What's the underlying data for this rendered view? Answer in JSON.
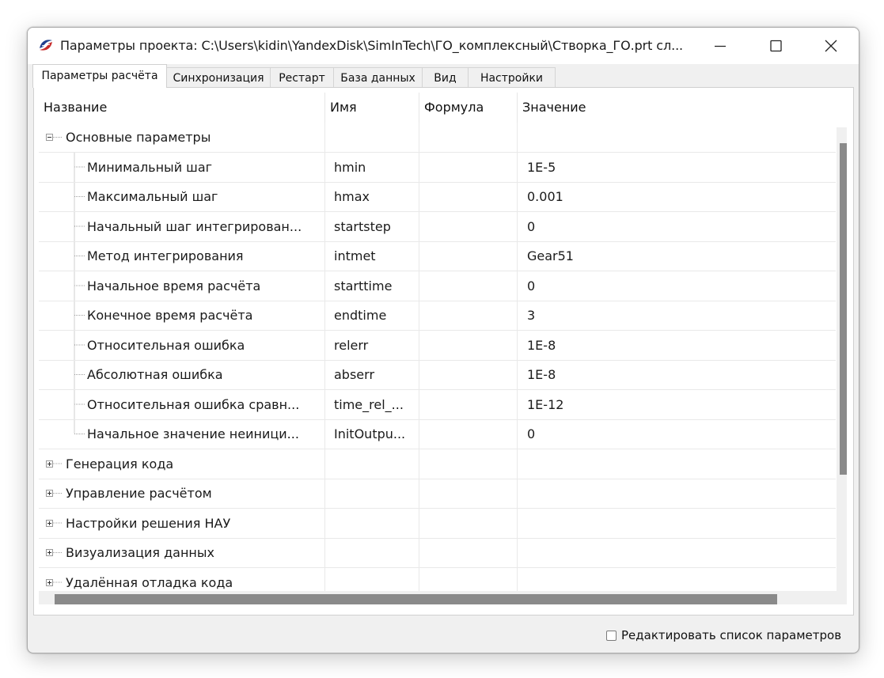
{
  "window": {
    "title": "Параметры проекта: C:\\Users\\kidin\\YandexDisk\\SimInTech\\ГО_комплексный\\Створка_ГО.prt  сл...",
    "icon": "simintech-logo-icon",
    "controls": [
      "minimize-icon",
      "maximize-icon",
      "close-icon"
    ]
  },
  "tabs": [
    {
      "label": "Параметры расчёта",
      "active": true
    },
    {
      "label": "Синхронизация",
      "active": false
    },
    {
      "label": "Рестарт",
      "active": false
    },
    {
      "label": "База данных",
      "active": false
    },
    {
      "label": "Вид",
      "active": false
    },
    {
      "label": "Настройки",
      "active": false
    }
  ],
  "table": {
    "columns": [
      "Название",
      "Имя",
      "Формула",
      "Значение"
    ],
    "rows": [
      {
        "name": "Основные параметры",
        "var": "",
        "formula": "",
        "value": "",
        "level": 0,
        "expander": "minus"
      },
      {
        "name": "Минимальный шаг",
        "var": "hmin",
        "formula": "",
        "value": "1E-5",
        "level": 1
      },
      {
        "name": "Максимальный шаг",
        "var": "hmax",
        "formula": "",
        "value": "0.001",
        "level": 1
      },
      {
        "name": "Начальный шаг интегрирован...",
        "var": "startstep",
        "formula": "",
        "value": "0",
        "level": 1
      },
      {
        "name": "Метод интегрирования",
        "var": "intmet",
        "formula": "",
        "value": "Gear51",
        "level": 1
      },
      {
        "name": "Начальное время расчёта",
        "var": "starttime",
        "formula": "",
        "value": "0",
        "level": 1
      },
      {
        "name": "Конечное время расчёта",
        "var": "endtime",
        "formula": "",
        "value": "3",
        "level": 1
      },
      {
        "name": "Относительная ошибка",
        "var": "relerr",
        "formula": "",
        "value": "1E-8",
        "level": 1
      },
      {
        "name": "Абсолютная ошибка",
        "var": "abserr",
        "formula": "",
        "value": "1E-8",
        "level": 1
      },
      {
        "name": "Относительная ошибка сравн...",
        "var": "time_rel_...",
        "formula": "",
        "value": "1E-12",
        "level": 1
      },
      {
        "name": "Начальное значение неиници...",
        "var": "InitOutpu...",
        "formula": "",
        "value": "0",
        "level": 1
      },
      {
        "name": "Генерация кода",
        "var": "",
        "formula": "",
        "value": "",
        "level": 0,
        "expander": "plus"
      },
      {
        "name": "Управление расчётом",
        "var": "",
        "formula": "",
        "value": "",
        "level": 0,
        "expander": "plus"
      },
      {
        "name": "Настройки решения НАУ",
        "var": "",
        "formula": "",
        "value": "",
        "level": 0,
        "expander": "plus"
      },
      {
        "name": "Визуализация данных",
        "var": "",
        "formula": "",
        "value": "",
        "level": 0,
        "expander": "plus"
      },
      {
        "name": "Удалённая отладка кода",
        "var": "",
        "formula": "",
        "value": "",
        "level": 0,
        "expander": "plus"
      }
    ]
  },
  "scroll": {
    "vertical_visible_fraction": 0.74,
    "horizontal_visible_fraction": 0.94
  },
  "footer": {
    "checkbox_label": "Редактировать список параметров",
    "checked": false
  }
}
